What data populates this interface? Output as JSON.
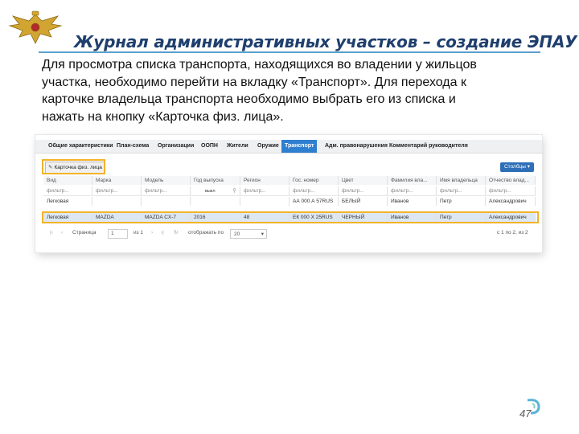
{
  "slide": {
    "title": "Журнал административных участков – создание ЭПАУ",
    "description_lines": [
      "Для просмотра списка транспорта, находящихся во владении у жильцов",
      "участка, необходимо перейти на вкладку «Транспорт». Для перехода к",
      "карточке владельца транспорта необходимо выбрать его из списка и",
      "нажать на кнопку «Карточка физ. лица»."
    ],
    "page_number": "47",
    "emblem_icon": "double-headed-eagle-emblem",
    "accent_color": "#f3b32a",
    "title_color": "#1f3f6e"
  },
  "app": {
    "tabs": [
      {
        "label": "Общие характеристики"
      },
      {
        "label": "План-схема"
      },
      {
        "label": "Организации"
      },
      {
        "label": "ООПН"
      },
      {
        "label": "Жители"
      },
      {
        "label": "Оружие"
      },
      {
        "label": "Транспорт",
        "active": true
      },
      {
        "label": "Адм. правонарушения"
      },
      {
        "label": "Комментарий руководителя"
      }
    ],
    "toolbar": {
      "card_button_label": "Карточка физ. лица",
      "columns_button_label": "Столбцы"
    },
    "table": {
      "columns": [
        "Вид",
        "Марка",
        "Модель",
        "Год выпуска",
        "Регион",
        "Гос. номер",
        "Цвет",
        "Фамилия вла...",
        "Имя владельца",
        "Отчество влад..."
      ],
      "filter_placeholder": "фильтр...",
      "year_filter_button": "выкл",
      "rows": [
        [
          "Легковая",
          "",
          "",
          "",
          "",
          "АА 000 А 57RUS",
          "БЕЛЫЙ",
          "Иванов",
          "Петр",
          "Александрович"
        ],
        [
          "Легковая",
          "MAZDA",
          "MAZDA CX-7",
          "2016",
          "48",
          "ЕК 000 Х 25RUS",
          "ЧЕРНЫЙ",
          "Иванов",
          "Петр",
          "Александрович"
        ]
      ],
      "selected_row": 1
    },
    "pager": {
      "page_label": "Страница",
      "page_value": "1",
      "of_label": "из 1",
      "show_label": "отображать по",
      "show_value": "20",
      "summary": "с 1 по 2, из 2"
    }
  }
}
